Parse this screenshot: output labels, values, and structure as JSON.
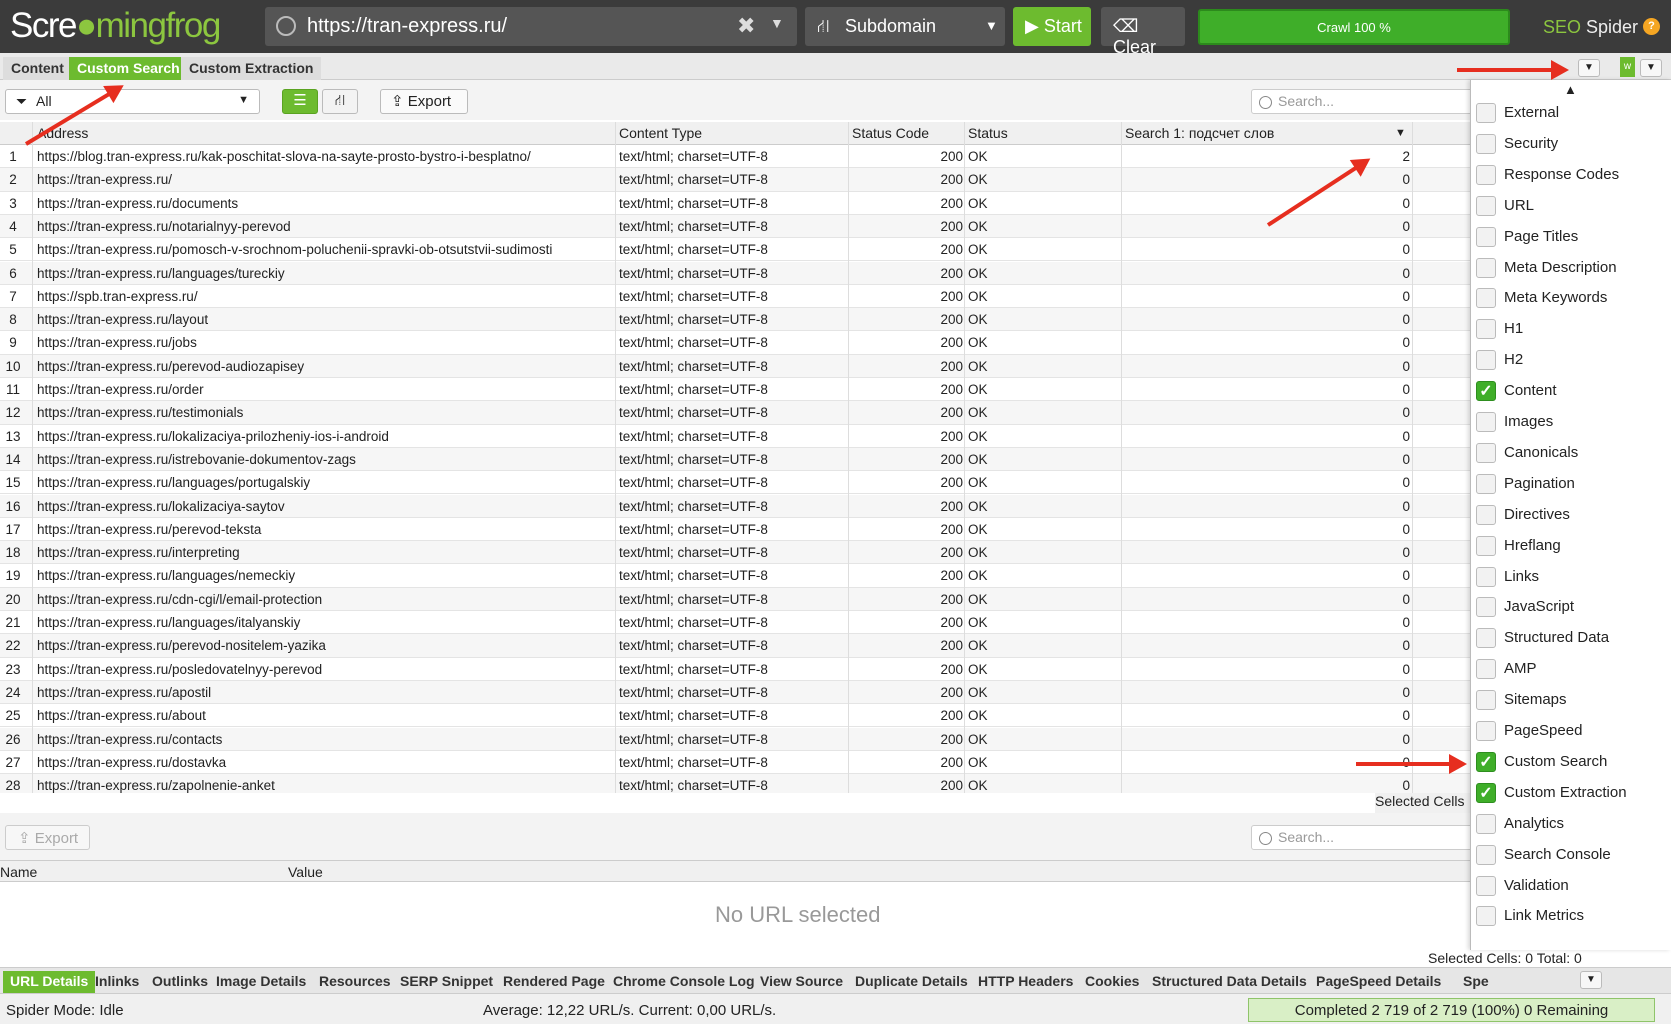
{
  "app": {
    "logo_pre": "Scre",
    "logo_mid": "mingfrog",
    "product_pre": "SEO",
    "product_post": " Spider"
  },
  "topbar": {
    "url": "https://tran-express.ru/",
    "mode": "Subdomain",
    "start": "Start",
    "clear": "Clear",
    "crawl": "Crawl 100 %"
  },
  "tabs": [
    "Content",
    "Custom Search",
    "Custom Extraction"
  ],
  "toolbar": {
    "filter": "All",
    "export": "Export",
    "search_placeholder": "Search..."
  },
  "columns": [
    "Address",
    "Content Type",
    "Status Code",
    "Status",
    "Search 1: подсчет слов"
  ],
  "rows": [
    {
      "n": "1",
      "a": "https://blog.tran-express.ru/kak-poschitat-slova-na-sayte-prosto-bystro-i-besplatno/",
      "ct": "text/html; charset=UTF-8",
      "sc": "200",
      "st": "OK",
      "sv": "2"
    },
    {
      "n": "2",
      "a": "https://tran-express.ru/",
      "ct": "text/html; charset=UTF-8",
      "sc": "200",
      "st": "OK",
      "sv": "0"
    },
    {
      "n": "3",
      "a": "https://tran-express.ru/documents",
      "ct": "text/html; charset=UTF-8",
      "sc": "200",
      "st": "OK",
      "sv": "0"
    },
    {
      "n": "4",
      "a": "https://tran-express.ru/notarialnyy-perevod",
      "ct": "text/html; charset=UTF-8",
      "sc": "200",
      "st": "OK",
      "sv": "0"
    },
    {
      "n": "5",
      "a": "https://tran-express.ru/pomosch-v-srochnom-poluchenii-spravki-ob-otsutstvii-sudimosti",
      "ct": "text/html; charset=UTF-8",
      "sc": "200",
      "st": "OK",
      "sv": "0"
    },
    {
      "n": "6",
      "a": "https://tran-express.ru/languages/tureckiy",
      "ct": "text/html; charset=UTF-8",
      "sc": "200",
      "st": "OK",
      "sv": "0"
    },
    {
      "n": "7",
      "a": "https://spb.tran-express.ru/",
      "ct": "text/html; charset=UTF-8",
      "sc": "200",
      "st": "OK",
      "sv": "0"
    },
    {
      "n": "8",
      "a": "https://tran-express.ru/layout",
      "ct": "text/html; charset=UTF-8",
      "sc": "200",
      "st": "OK",
      "sv": "0"
    },
    {
      "n": "9",
      "a": "https://tran-express.ru/jobs",
      "ct": "text/html; charset=UTF-8",
      "sc": "200",
      "st": "OK",
      "sv": "0"
    },
    {
      "n": "10",
      "a": "https://tran-express.ru/perevod-audiozapisey",
      "ct": "text/html; charset=UTF-8",
      "sc": "200",
      "st": "OK",
      "sv": "0"
    },
    {
      "n": "11",
      "a": "https://tran-express.ru/order",
      "ct": "text/html; charset=UTF-8",
      "sc": "200",
      "st": "OK",
      "sv": "0"
    },
    {
      "n": "12",
      "a": "https://tran-express.ru/testimonials",
      "ct": "text/html; charset=UTF-8",
      "sc": "200",
      "st": "OK",
      "sv": "0"
    },
    {
      "n": "13",
      "a": "https://tran-express.ru/lokalizaciya-prilozheniy-ios-i-android",
      "ct": "text/html; charset=UTF-8",
      "sc": "200",
      "st": "OK",
      "sv": "0"
    },
    {
      "n": "14",
      "a": "https://tran-express.ru/istrebovanie-dokumentov-zags",
      "ct": "text/html; charset=UTF-8",
      "sc": "200",
      "st": "OK",
      "sv": "0"
    },
    {
      "n": "15",
      "a": "https://tran-express.ru/languages/portugalskiy",
      "ct": "text/html; charset=UTF-8",
      "sc": "200",
      "st": "OK",
      "sv": "0"
    },
    {
      "n": "16",
      "a": "https://tran-express.ru/lokalizaciya-saytov",
      "ct": "text/html; charset=UTF-8",
      "sc": "200",
      "st": "OK",
      "sv": "0"
    },
    {
      "n": "17",
      "a": "https://tran-express.ru/perevod-teksta",
      "ct": "text/html; charset=UTF-8",
      "sc": "200",
      "st": "OK",
      "sv": "0"
    },
    {
      "n": "18",
      "a": "https://tran-express.ru/interpreting",
      "ct": "text/html; charset=UTF-8",
      "sc": "200",
      "st": "OK",
      "sv": "0"
    },
    {
      "n": "19",
      "a": "https://tran-express.ru/languages/nemeckiy",
      "ct": "text/html; charset=UTF-8",
      "sc": "200",
      "st": "OK",
      "sv": "0"
    },
    {
      "n": "20",
      "a": "https://tran-express.ru/cdn-cgi/l/email-protection",
      "ct": "text/html; charset=UTF-8",
      "sc": "200",
      "st": "OK",
      "sv": "0"
    },
    {
      "n": "21",
      "a": "https://tran-express.ru/languages/italyanskiy",
      "ct": "text/html; charset=UTF-8",
      "sc": "200",
      "st": "OK",
      "sv": "0"
    },
    {
      "n": "22",
      "a": "https://tran-express.ru/perevod-nositelem-yazika",
      "ct": "text/html; charset=UTF-8",
      "sc": "200",
      "st": "OK",
      "sv": "0"
    },
    {
      "n": "23",
      "a": "https://tran-express.ru/posledovatelnyy-perevod",
      "ct": "text/html; charset=UTF-8",
      "sc": "200",
      "st": "OK",
      "sv": "0"
    },
    {
      "n": "24",
      "a": "https://tran-express.ru/apostil",
      "ct": "text/html; charset=UTF-8",
      "sc": "200",
      "st": "OK",
      "sv": "0"
    },
    {
      "n": "25",
      "a": "https://tran-express.ru/about",
      "ct": "text/html; charset=UTF-8",
      "sc": "200",
      "st": "OK",
      "sv": "0"
    },
    {
      "n": "26",
      "a": "https://tran-express.ru/contacts",
      "ct": "text/html; charset=UTF-8",
      "sc": "200",
      "st": "OK",
      "sv": "0"
    },
    {
      "n": "27",
      "a": "https://tran-express.ru/dostavka",
      "ct": "text/html; charset=UTF-8",
      "sc": "200",
      "st": "OK",
      "sv": "0"
    },
    {
      "n": "28",
      "a": "https://tran-express.ru/zapolnenie-anket",
      "ct": "text/html; charset=UTF-8",
      "sc": "200",
      "st": "OK",
      "sv": "0"
    }
  ],
  "grid_footer": {
    "selected": "Selected Cells"
  },
  "lower": {
    "export": "Export",
    "search_placeholder": "Search...",
    "col_name": "Name",
    "col_value": "Value",
    "empty": "No URL selected",
    "selected": "Selected Cells:  0  Total:  0"
  },
  "bottom_tabs": [
    "URL Details",
    "Inlinks",
    "Outlinks",
    "Image Details",
    "Resources",
    "SERP Snippet",
    "Rendered Page",
    "Chrome Console Log",
    "View Source",
    "Duplicate Details",
    "HTTP Headers",
    "Cookies",
    "Structured Data Details",
    "PageSpeed Details",
    "Spe"
  ],
  "status": {
    "mode": "Spider Mode: Idle",
    "speed": "Average: 12,22 URL/s. Current: 0,00 URL/s.",
    "progress": "Completed 2 719 of 2 719 (100%) 0 Remaining"
  },
  "panel_items": [
    {
      "label": "External",
      "checked": false
    },
    {
      "label": "Security",
      "checked": false
    },
    {
      "label": "Response Codes",
      "checked": false
    },
    {
      "label": "URL",
      "checked": false
    },
    {
      "label": "Page Titles",
      "checked": false
    },
    {
      "label": "Meta Description",
      "checked": false
    },
    {
      "label": "Meta Keywords",
      "checked": false
    },
    {
      "label": "H1",
      "checked": false
    },
    {
      "label": "H2",
      "checked": false
    },
    {
      "label": "Content",
      "checked": true
    },
    {
      "label": "Images",
      "checked": false
    },
    {
      "label": "Canonicals",
      "checked": false
    },
    {
      "label": "Pagination",
      "checked": false
    },
    {
      "label": "Directives",
      "checked": false
    },
    {
      "label": "Hreflang",
      "checked": false
    },
    {
      "label": "Links",
      "checked": false
    },
    {
      "label": "JavaScript",
      "checked": false
    },
    {
      "label": "Structured Data",
      "checked": false
    },
    {
      "label": "AMP",
      "checked": false
    },
    {
      "label": "Sitemaps",
      "checked": false
    },
    {
      "label": "PageSpeed",
      "checked": false
    },
    {
      "label": "Custom Search",
      "checked": true
    },
    {
      "label": "Custom Extraction",
      "checked": true
    },
    {
      "label": "Analytics",
      "checked": false
    },
    {
      "label": "Search Console",
      "checked": false
    },
    {
      "label": "Validation",
      "checked": false
    },
    {
      "label": "Link Metrics",
      "checked": false
    }
  ],
  "colors": {
    "accent": "#6dbb2f",
    "annotation": "#e62e1f",
    "topbar": "#3b3b3b"
  }
}
